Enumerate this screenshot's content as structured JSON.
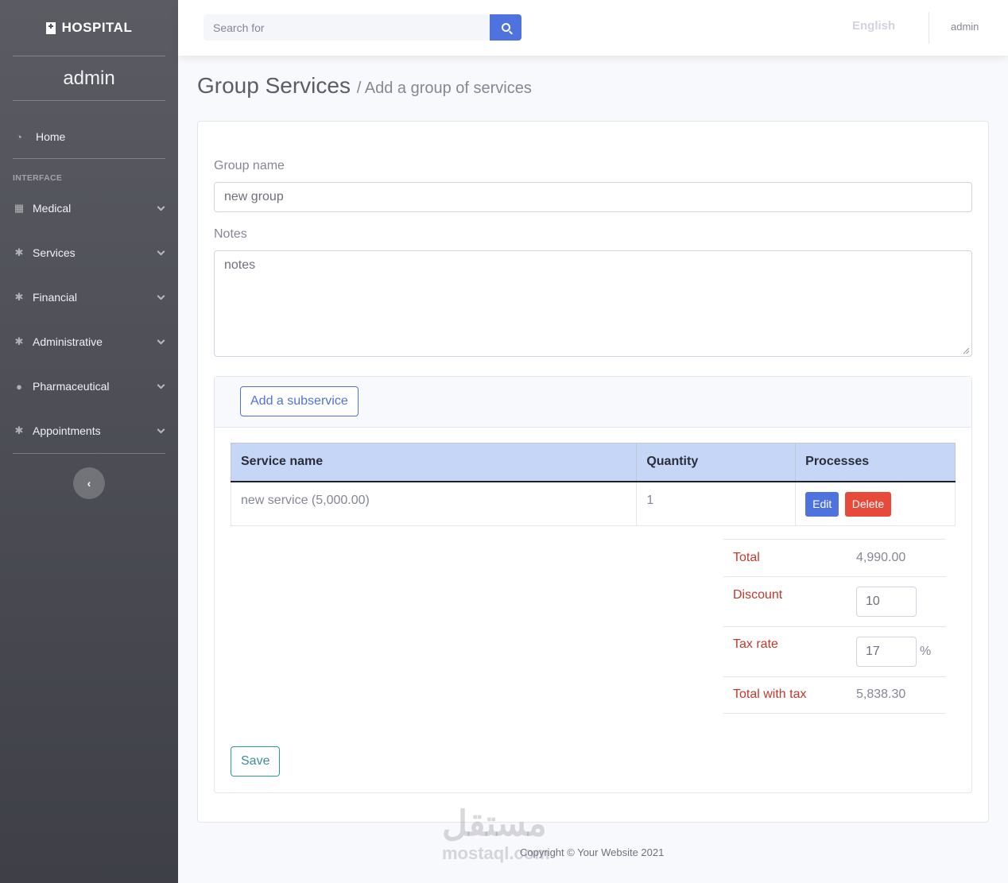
{
  "sidebar": {
    "brand": "HOSPITAL",
    "user": "admin",
    "home": "Home",
    "heading": "INTERFACE",
    "items": [
      {
        "label": "Medical",
        "icon": "table-icon"
      },
      {
        "label": "Services",
        "icon": "gear-icon"
      },
      {
        "label": "Financial",
        "icon": "gear-icon"
      },
      {
        "label": "Administrative",
        "icon": "gear-icon"
      },
      {
        "label": "Pharmaceutical",
        "icon": "user-icon"
      },
      {
        "label": "Appointments",
        "icon": "gear-icon"
      }
    ],
    "toggle": "‹"
  },
  "topbar": {
    "search_placeholder": "Search for",
    "language": "English",
    "user": "admin"
  },
  "page": {
    "title": "Group Services",
    "subtitle": "/ Add a group of services"
  },
  "form": {
    "group_name_label": "Group name",
    "group_name_value": "new group",
    "notes_label": "Notes",
    "notes_value": "notes",
    "add_subservice": "Add a subservice",
    "table": {
      "headers": [
        "Service name",
        "Quantity",
        "Processes"
      ],
      "rows": [
        {
          "service": "new service (5,000.00)",
          "quantity": "1",
          "edit": "Edit",
          "delete": "Delete"
        }
      ]
    },
    "totals": {
      "total_label": "Total",
      "total_value": "4,990.00",
      "discount_label": "Discount",
      "discount_value": "10",
      "tax_label": "Tax rate",
      "tax_value": "17",
      "tax_unit": "%",
      "total_tax_label": "Total with tax",
      "total_tax_value": "5,838.30"
    },
    "save": "Save"
  },
  "footer": "Copyright © Your Website 2021",
  "watermark": {
    "arabic": "مستقل",
    "latin": "mostaql.com"
  },
  "colors": {
    "primary": "#4e73df",
    "danger": "#e74a3b",
    "table_header": "#c6d6f7"
  }
}
